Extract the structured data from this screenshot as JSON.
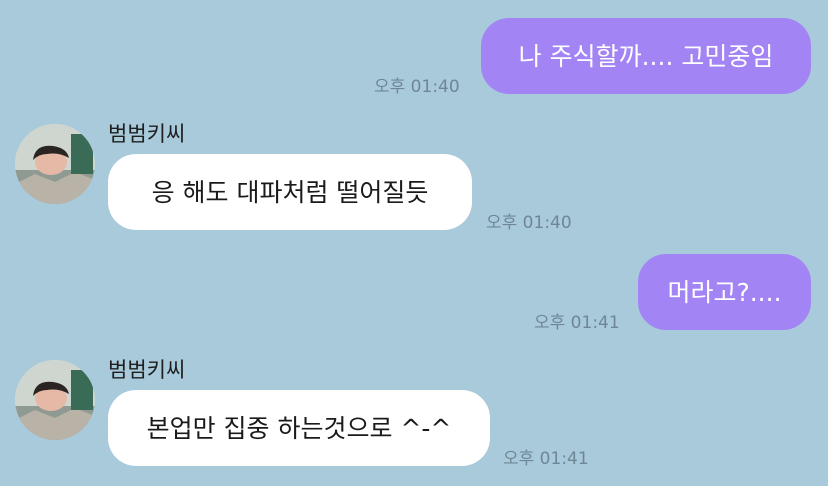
{
  "colors": {
    "background": "#a9cadb",
    "sent_bubble": "#a284f4",
    "received_bubble": "#ffffff",
    "timestamp": "#6f8794"
  },
  "messages": [
    {
      "direction": "sent",
      "text": "나 주식할까.... 고민중임",
      "time": "오후 01:40"
    },
    {
      "direction": "received",
      "sender": "범범키씨",
      "avatar": "profile-photo",
      "text": "응 해도 대파처럼 떨어질듯",
      "time": "오후 01:40"
    },
    {
      "direction": "sent",
      "text": "머라고?....",
      "time": "오후 01:41"
    },
    {
      "direction": "received",
      "sender": "범범키씨",
      "avatar": "profile-photo",
      "text": "본업만 집중 하는것으로 ^-^",
      "time": "오후 01:41"
    }
  ]
}
